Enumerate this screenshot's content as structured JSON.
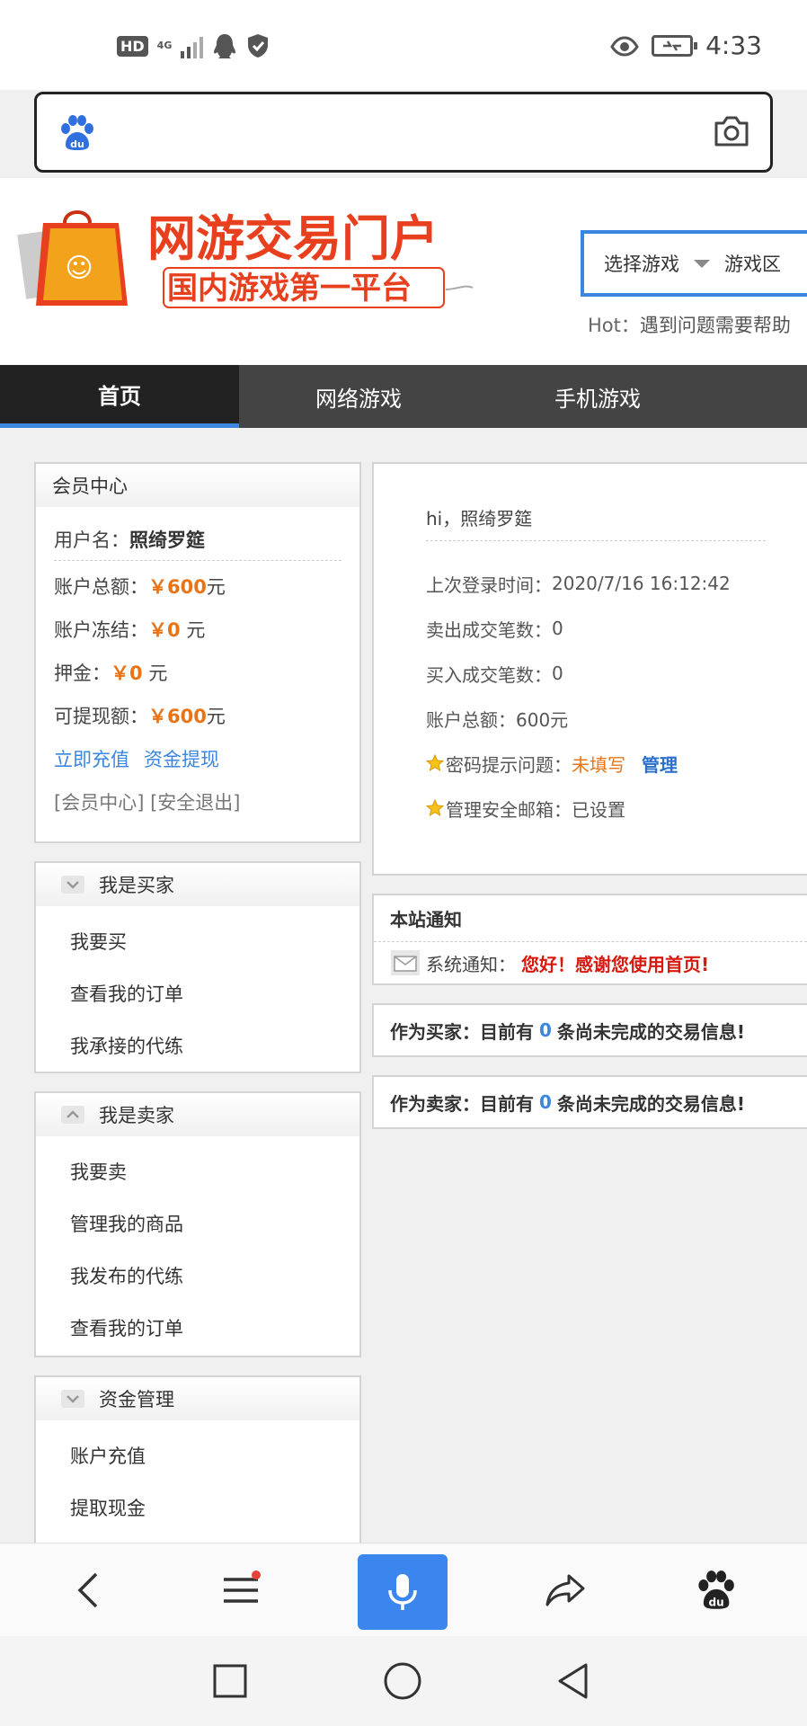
{
  "status_bar": {
    "left_badges": [
      "HD",
      "4G"
    ],
    "time": "4:33"
  },
  "search": {
    "left_icon": "baidu-paw-icon",
    "right_icon": "camera-icon"
  },
  "header": {
    "logo_title": "网游交易门户",
    "logo_subtitle": "国内游戏第一平台",
    "selector_game": "选择游戏",
    "selector_zone": "游戏区",
    "hot_label": "Hot：",
    "hot_text": "遇到问题需要帮助"
  },
  "nav": {
    "tabs": [
      {
        "label": "首页",
        "active": true
      },
      {
        "label": "网络游戏",
        "active": false
      },
      {
        "label": "手机游戏",
        "active": false
      }
    ]
  },
  "member": {
    "title": "会员中心",
    "username_label": "用户名：",
    "username": "照绮罗筵",
    "balance_label": "账户总额：",
    "balance_value": "￥600",
    "frozen_label": "账户冻结：",
    "frozen_value": "￥0",
    "deposit_label": "押金：",
    "deposit_value": "￥0",
    "withdrawable_label": "可提现额：",
    "withdrawable_value": "￥600",
    "unit": "元",
    "recharge_link": "立即充值",
    "withdraw_link": "资金提现",
    "center_link": "[会员中心]",
    "logout_link": "[安全退出]"
  },
  "buyer": {
    "title": "我是买家",
    "items": [
      "我要买",
      "查看我的订单",
      "我承接的代练"
    ]
  },
  "seller": {
    "title": "我是卖家",
    "items": [
      "我要卖",
      "管理我的商品",
      "我发布的代练",
      "查看我的订单"
    ]
  },
  "funds": {
    "title": "资金管理",
    "items": [
      "账户充值",
      "提取现金"
    ]
  },
  "info": {
    "greeting": "hi，照绮罗筵",
    "last_login_label": "上次登录时间：",
    "last_login": "2020/7/16 16:12:42",
    "sold_label": "卖出成交笔数：",
    "sold": "0",
    "bought_label": "买入成交笔数：",
    "bought": "0",
    "total_label": "账户总额：",
    "total": "600元",
    "pwd_q_label": "密码提示问题：",
    "pwd_q_value": "未填写",
    "pwd_q_manage": "管理",
    "email_label": "管理安全邮箱：",
    "email_value": "已设置"
  },
  "notice": {
    "title": "本站通知",
    "sys_label": "系统通知：",
    "sys_text": "您好！感谢您使用首页!"
  },
  "trades": {
    "buyer_prefix": "作为买家：目前有",
    "buyer_count": "0",
    "buyer_suffix": "条尚未完成的交易信息!",
    "seller_prefix": "作为卖家：目前有",
    "seller_count": "0",
    "seller_suffix": "条尚未完成的交易信息!"
  },
  "colors": {
    "accent": "#3b86e0",
    "money": "#e87416",
    "alert": "#d8190f",
    "nav_bg": "#444444"
  }
}
